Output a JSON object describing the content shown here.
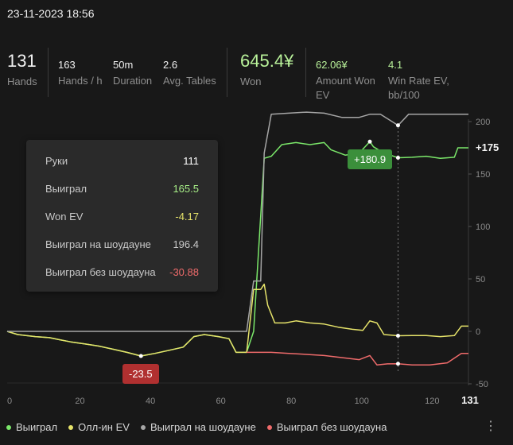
{
  "date": "23-11-2023 18:56",
  "stats": {
    "hands": {
      "value": "131",
      "label": "Hands"
    },
    "hands_per_hour": {
      "value": "163",
      "label": "Hands / h"
    },
    "duration": {
      "value": "50m",
      "label": "Duration"
    },
    "avg_tables": {
      "value": "2.6",
      "label": "Avg. Tables"
    },
    "won": {
      "value": "645.4¥",
      "label": "Won"
    },
    "amount_won_ev": {
      "value": "62.06¥",
      "label": "Amount Won EV"
    },
    "win_rate_ev": {
      "value": "4.1",
      "label": "Win Rate EV, bb/100"
    }
  },
  "tooltip": {
    "rows": [
      {
        "label": "Руки",
        "value": "111",
        "color": "#ffffff"
      },
      {
        "label": "Выиграл",
        "value": "165.5",
        "color": "#a6ec86"
      },
      {
        "label": "Won EV",
        "value": "-4.17",
        "color": "#e6e36a"
      },
      {
        "label": "Выиграл на шоудауне",
        "value": "196.4",
        "color": "#c8c8c8"
      },
      {
        "label": "Выиграл без шоудауна",
        "value": "-30.88",
        "color": "#ef6b6b"
      }
    ]
  },
  "badges": {
    "max": {
      "text": "+180.9",
      "color": "#3b8f3b"
    },
    "min": {
      "text": "-23.5",
      "color": "#b03030"
    }
  },
  "end_label": "+175",
  "more_icon": "⋮",
  "chart_data": {
    "type": "line",
    "xlim": [
      0,
      131
    ],
    "ylim": [
      -50,
      210
    ],
    "x_ticks": [
      0,
      20,
      40,
      60,
      80,
      100,
      120,
      131
    ],
    "y_ticks": [
      -50,
      0,
      50,
      100,
      150,
      200
    ],
    "series": [
      {
        "name": "Выиграл",
        "color": "#7be86a",
        "points": [
          [
            0,
            0
          ],
          [
            3,
            -3
          ],
          [
            8,
            -5
          ],
          [
            12,
            -6
          ],
          [
            15,
            -8
          ],
          [
            18,
            -10
          ],
          [
            22,
            -12
          ],
          [
            26,
            -14
          ],
          [
            30,
            -17
          ],
          [
            34,
            -20
          ],
          [
            38,
            -23.5
          ],
          [
            42,
            -21
          ],
          [
            46,
            -18
          ],
          [
            50,
            -15
          ],
          [
            53,
            -5
          ],
          [
            56,
            -3
          ],
          [
            60,
            -5
          ],
          [
            63,
            -7
          ],
          [
            65,
            -20
          ],
          [
            67,
            -20
          ],
          [
            68,
            -20
          ],
          [
            70,
            0
          ],
          [
            73,
            165
          ],
          [
            75,
            167
          ],
          [
            78,
            178
          ],
          [
            82,
            180
          ],
          [
            86,
            178
          ],
          [
            90,
            180
          ],
          [
            92,
            173
          ],
          [
            96,
            168
          ],
          [
            100,
            170
          ],
          [
            103,
            180.9
          ],
          [
            104,
            176
          ],
          [
            107,
            170
          ],
          [
            111,
            165.5
          ],
          [
            115,
            166
          ],
          [
            119,
            167
          ],
          [
            123,
            165
          ],
          [
            127,
            166
          ],
          [
            128,
            175
          ],
          [
            131,
            175
          ]
        ]
      },
      {
        "name": "Олл-ин EV",
        "color": "#e6e36a",
        "points": [
          [
            0,
            0
          ],
          [
            3,
            -3
          ],
          [
            8,
            -5
          ],
          [
            12,
            -6
          ],
          [
            15,
            -8
          ],
          [
            18,
            -10
          ],
          [
            22,
            -12
          ],
          [
            26,
            -14
          ],
          [
            30,
            -17
          ],
          [
            34,
            -20
          ],
          [
            38,
            -23.5
          ],
          [
            42,
            -21
          ],
          [
            46,
            -18
          ],
          [
            50,
            -15
          ],
          [
            53,
            -5
          ],
          [
            56,
            -3
          ],
          [
            60,
            -5
          ],
          [
            63,
            -7
          ],
          [
            65,
            -20
          ],
          [
            67,
            -20
          ],
          [
            68,
            -20
          ],
          [
            70,
            40
          ],
          [
            72,
            40
          ],
          [
            73,
            45
          ],
          [
            74,
            25
          ],
          [
            76,
            8
          ],
          [
            79,
            8
          ],
          [
            82,
            10
          ],
          [
            86,
            8
          ],
          [
            90,
            7
          ],
          [
            94,
            4
          ],
          [
            98,
            2
          ],
          [
            101,
            1
          ],
          [
            103,
            10
          ],
          [
            105,
            8
          ],
          [
            107,
            -3
          ],
          [
            111,
            -4.17
          ],
          [
            115,
            -4
          ],
          [
            119,
            -4
          ],
          [
            123,
            -5
          ],
          [
            127,
            -4
          ],
          [
            129,
            5
          ],
          [
            131,
            5
          ]
        ]
      },
      {
        "name": "Выиграл на шоудауне",
        "color": "#a6a6a6",
        "points": [
          [
            0,
            0
          ],
          [
            68,
            0
          ],
          [
            70,
            48
          ],
          [
            72,
            48
          ],
          [
            73,
            170
          ],
          [
            75,
            207
          ],
          [
            80,
            208
          ],
          [
            85,
            209
          ],
          [
            90,
            208
          ],
          [
            95,
            204
          ],
          [
            100,
            204
          ],
          [
            103,
            207
          ],
          [
            106,
            207
          ],
          [
            111,
            196.4
          ],
          [
            114,
            207
          ],
          [
            120,
            207
          ],
          [
            131,
            207
          ]
        ]
      },
      {
        "name": "Выиграл без шоудауна",
        "color": "#ef6b6b",
        "points": [
          [
            68,
            -20
          ],
          [
            75,
            -20
          ],
          [
            80,
            -21
          ],
          [
            85,
            -22
          ],
          [
            90,
            -23
          ],
          [
            95,
            -25
          ],
          [
            100,
            -27
          ],
          [
            103,
            -23
          ],
          [
            105,
            -32
          ],
          [
            108,
            -31
          ],
          [
            111,
            -30.88
          ],
          [
            115,
            -32
          ],
          [
            120,
            -32
          ],
          [
            125,
            -30
          ],
          [
            129,
            -21
          ],
          [
            131,
            -21
          ]
        ]
      }
    ],
    "grid": false,
    "legend": "bottom-left"
  }
}
